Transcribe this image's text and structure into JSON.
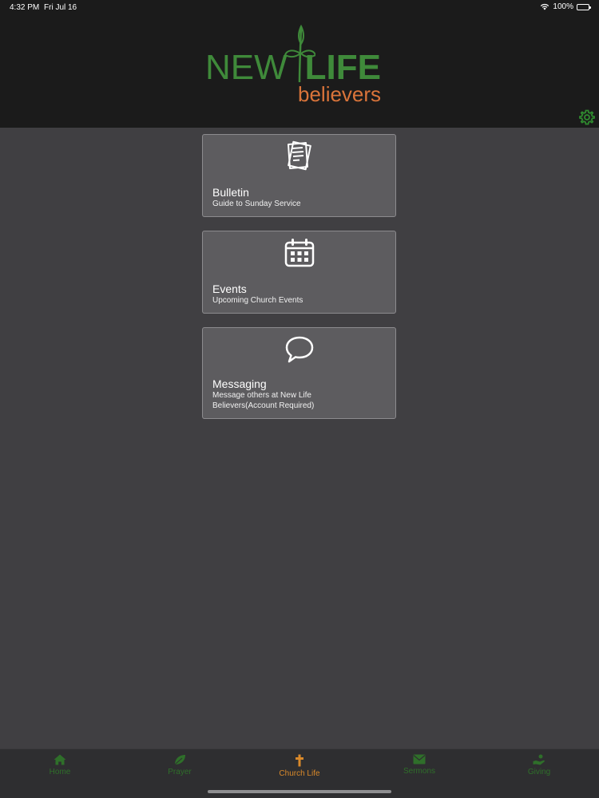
{
  "status_bar": {
    "time": "4:32 PM",
    "date": "Fri Jul 16",
    "battery": "100%",
    "battery_level": 1.0
  },
  "logo": {
    "word1": "NEW",
    "word2": "LIFE",
    "word3": "believers"
  },
  "colors": {
    "brand_green": "#3f8a3a",
    "brand_orange": "#d9743a",
    "tab_active": "#d9892a",
    "tab_inactive": "#2f6f2a"
  },
  "cards": [
    {
      "icon": "bulletin-icon",
      "title": "Bulletin",
      "subtitle": "Guide to Sunday Service"
    },
    {
      "icon": "calendar-icon",
      "title": "Events",
      "subtitle": "Upcoming Church Events"
    },
    {
      "icon": "speech-bubble-icon",
      "title": "Messaging",
      "subtitle": "Message others at New Life Believers(Account Required)"
    }
  ],
  "tabs": [
    {
      "icon": "home-icon",
      "label": "Home",
      "active": false
    },
    {
      "icon": "leaf-icon",
      "label": "Prayer",
      "active": false
    },
    {
      "icon": "cross-icon",
      "label": "Church Life",
      "active": true
    },
    {
      "icon": "envelope-icon",
      "label": "Sermons",
      "active": false
    },
    {
      "icon": "giving-hand-icon",
      "label": "Giving",
      "active": false
    }
  ]
}
